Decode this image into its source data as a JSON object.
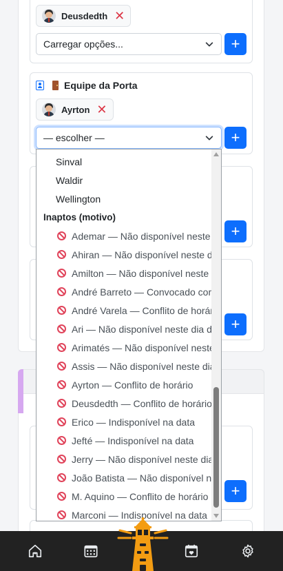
{
  "top_card": {
    "chip_name": "Deusdedth",
    "remove_symbol": "✕",
    "select_value": "Carregar opções...",
    "add_symbol": "+"
  },
  "porta_card": {
    "title": "Equipe da Porta",
    "chip_name": "Ayrton",
    "remove_symbol": "✕",
    "select_value": "— escolher —",
    "add_symbol": "+"
  },
  "hidden_add_symbol": "+",
  "dropdown": {
    "available": [
      "Sinval",
      "Waldir",
      "Wellington"
    ],
    "group_label": "Inaptos (motivo)",
    "inapt": [
      "Ademar — Não disponível neste dia da semana",
      "Ahiran — Não disponível neste dia da semana",
      "Amilton — Não disponível neste dia da semana",
      "André Barreto — Convocado como auxiliar",
      "André Varela — Conflito de horário",
      "Ari — Não disponível neste dia da semana",
      "Arimatés — Não disponível neste dia da semana",
      "Assis — Não disponível neste dia da semana",
      "Ayrton — Conflito de horário",
      "Deusdedth — Conflito de horário",
      "Erico — Indisponível na data",
      "Jefté — Indisponível na data",
      "Jerry — Não disponível neste dia da semana",
      "João Batista — Não disponível neste dia",
      "M. Aquino — Conflito de horário",
      "Marconi — Indisponível na data"
    ]
  },
  "nav": {
    "items": [
      "home-icon",
      "calendar-grid-icon",
      "lighthouse-logo",
      "calendar-heart-icon",
      "gear-icon"
    ]
  },
  "colors": {
    "primary": "#0d6efd",
    "danger": "#dc3545",
    "nav_bg": "#222222",
    "accent_purple": "#d6a8f0",
    "lighthouse_orange": "#f39c12"
  }
}
